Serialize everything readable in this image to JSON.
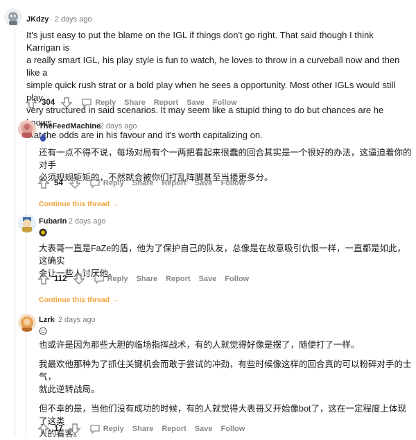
{
  "comments": [
    {
      "username": "JKdzy",
      "time": "2 days ago",
      "body_lines": [
        "It's just easy to put the blame on the IGL if things don't go right. That said though I think Karrigan is",
        "a really smart IGL, his play style is fun to watch, he loves to throw in a curveball now and then like a",
        "simple quick rush strat or a bold play when he sees a opportunity. Most other IGLs would still play",
        "very structured in said scenarios. It may seem like a stupid thing to do but chances are he knows",
        "that the odds are in his favour and it's worth capitalizing on."
      ],
      "score": "304",
      "actions": [
        "Reply",
        "Share",
        "Report",
        "Save",
        "Follow"
      ]
    },
    {
      "username": "TheFeedMachine",
      "time": "2 days ago",
      "flair_icon": "blue-flame-icon",
      "body_lines": [
        "还有一点不得不说，每场对局有个一两把看起来很蠢的回合其实是一个很好的办法，这逼迫着你的对手",
        "必须规规矩矩的，不然就会被你们打乱阵脚甚至当搂更多分。"
      ],
      "score": "54",
      "actions": [
        "Reply",
        "Share",
        "Report",
        "Save",
        "Follow"
      ],
      "continue": "Continue this thread →"
    },
    {
      "username": "Fubarin",
      "time": "2 days ago",
      "flair_icon": "yellow-rank-icon",
      "body_lines": [
        "大表哥一直是FaZe的盾，他为了保护自己的队友，总像是在故意吸引仇恨一样，一直都是如此，这确实",
        "会让一些人讨厌他。"
      ],
      "score": "112",
      "actions": [
        "Reply",
        "Share",
        "Report",
        "Save",
        "Follow"
      ],
      "continue": "Continue this thread →"
    },
    {
      "username": "Lzrk",
      "time": "2 days ago",
      "flair_icon": "smiley-icon",
      "paragraphs": [
        [
          "也或许是因为那些大胆的临场指挥战术，有的人就觉得好像是摆了，随便打了一样。"
        ],
        [
          "我最欢他那种为了抓住关键机会而敢于尝试的冲劲，有些时候像这样的回合真的可以粉碎对手的士气，",
          "就此逆转战局。"
        ],
        [
          "但不幸的是，当他们没有成功的时候，有的人就觉得大表哥又开始像bot了，这在一定程度上体现了这类",
          "人的看客。"
        ]
      ],
      "score": "17",
      "actions": [
        "Reply",
        "Share",
        "Report",
        "Save",
        "Follow"
      ]
    }
  ]
}
